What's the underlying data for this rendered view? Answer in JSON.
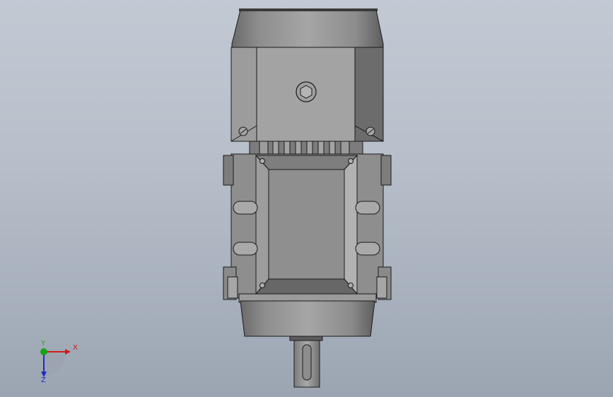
{
  "viewport": {
    "background_top": "#c2c9d3",
    "background_bottom": "#9ba5b2"
  },
  "model": {
    "body_color": "#9a9a9a",
    "edge_color": "#1a1a1a"
  },
  "triad": {
    "x_label": "X",
    "y_label": "Y",
    "z_label": "Z",
    "x_color": "#d11a1a",
    "y_color": "#1aa31a",
    "z_color": "#1a2fc4"
  }
}
